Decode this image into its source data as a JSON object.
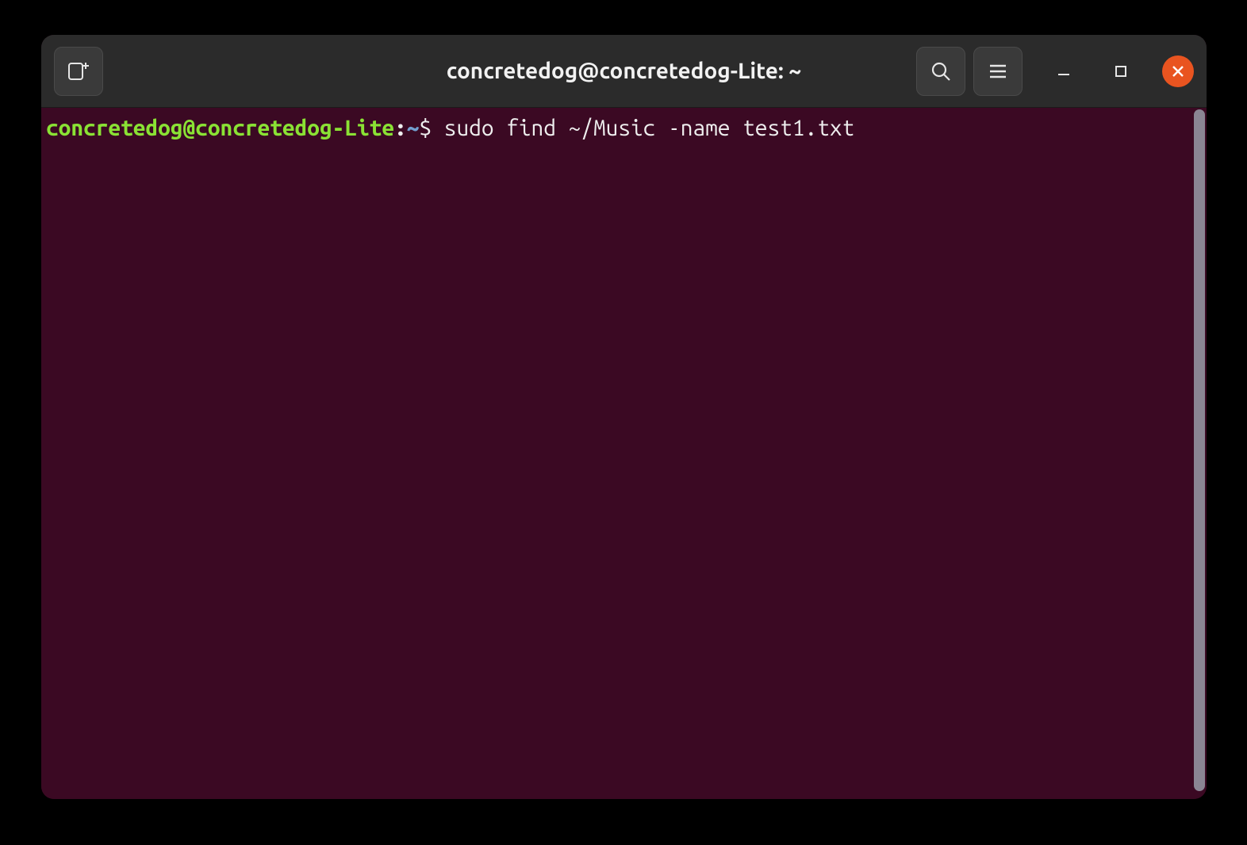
{
  "window": {
    "title": "concretedog@concretedog-Lite: ~"
  },
  "prompt": {
    "user_host": "concretedog@concretedog-Lite",
    "sep1": ":",
    "path": "~",
    "symbol": "$ ",
    "command": "sudo find ~/Music -name test1.txt"
  },
  "colors": {
    "terminal_bg": "#3b0923",
    "titlebar_bg": "#2b2b2b",
    "close_btn": "#e95420",
    "prompt_user": "#8ae234",
    "prompt_path": "#729fcf",
    "text": "#eeeeee"
  }
}
